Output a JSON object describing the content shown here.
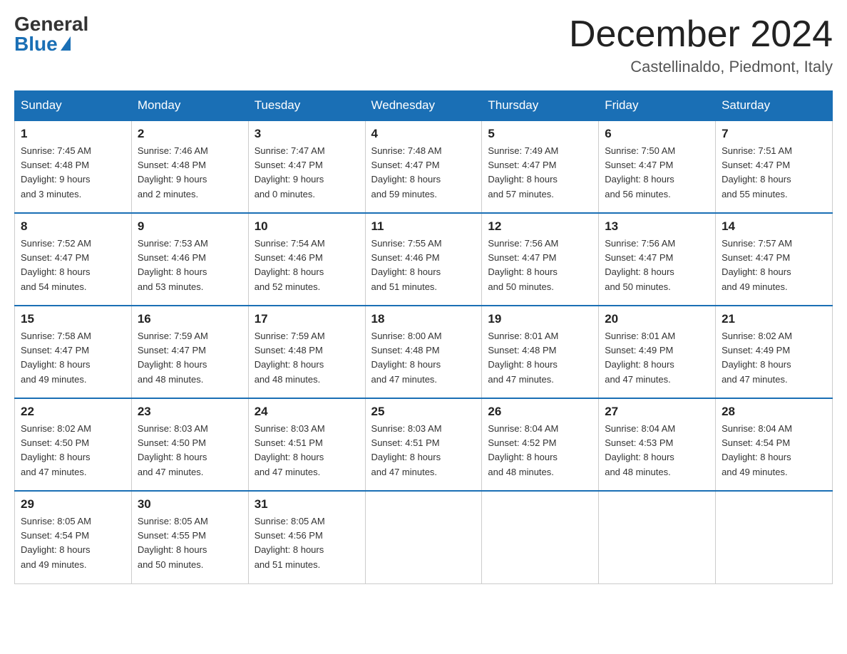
{
  "header": {
    "logo_general": "General",
    "logo_blue": "Blue",
    "title": "December 2024",
    "subtitle": "Castellinaldo, Piedmont, Italy"
  },
  "days_of_week": [
    "Sunday",
    "Monday",
    "Tuesday",
    "Wednesday",
    "Thursday",
    "Friday",
    "Saturday"
  ],
  "weeks": [
    [
      {
        "num": "1",
        "info": "Sunrise: 7:45 AM\nSunset: 4:48 PM\nDaylight: 9 hours\nand 3 minutes."
      },
      {
        "num": "2",
        "info": "Sunrise: 7:46 AM\nSunset: 4:48 PM\nDaylight: 9 hours\nand 2 minutes."
      },
      {
        "num": "3",
        "info": "Sunrise: 7:47 AM\nSunset: 4:47 PM\nDaylight: 9 hours\nand 0 minutes."
      },
      {
        "num": "4",
        "info": "Sunrise: 7:48 AM\nSunset: 4:47 PM\nDaylight: 8 hours\nand 59 minutes."
      },
      {
        "num": "5",
        "info": "Sunrise: 7:49 AM\nSunset: 4:47 PM\nDaylight: 8 hours\nand 57 minutes."
      },
      {
        "num": "6",
        "info": "Sunrise: 7:50 AM\nSunset: 4:47 PM\nDaylight: 8 hours\nand 56 minutes."
      },
      {
        "num": "7",
        "info": "Sunrise: 7:51 AM\nSunset: 4:47 PM\nDaylight: 8 hours\nand 55 minutes."
      }
    ],
    [
      {
        "num": "8",
        "info": "Sunrise: 7:52 AM\nSunset: 4:47 PM\nDaylight: 8 hours\nand 54 minutes."
      },
      {
        "num": "9",
        "info": "Sunrise: 7:53 AM\nSunset: 4:46 PM\nDaylight: 8 hours\nand 53 minutes."
      },
      {
        "num": "10",
        "info": "Sunrise: 7:54 AM\nSunset: 4:46 PM\nDaylight: 8 hours\nand 52 minutes."
      },
      {
        "num": "11",
        "info": "Sunrise: 7:55 AM\nSunset: 4:46 PM\nDaylight: 8 hours\nand 51 minutes."
      },
      {
        "num": "12",
        "info": "Sunrise: 7:56 AM\nSunset: 4:47 PM\nDaylight: 8 hours\nand 50 minutes."
      },
      {
        "num": "13",
        "info": "Sunrise: 7:56 AM\nSunset: 4:47 PM\nDaylight: 8 hours\nand 50 minutes."
      },
      {
        "num": "14",
        "info": "Sunrise: 7:57 AM\nSunset: 4:47 PM\nDaylight: 8 hours\nand 49 minutes."
      }
    ],
    [
      {
        "num": "15",
        "info": "Sunrise: 7:58 AM\nSunset: 4:47 PM\nDaylight: 8 hours\nand 49 minutes."
      },
      {
        "num": "16",
        "info": "Sunrise: 7:59 AM\nSunset: 4:47 PM\nDaylight: 8 hours\nand 48 minutes."
      },
      {
        "num": "17",
        "info": "Sunrise: 7:59 AM\nSunset: 4:48 PM\nDaylight: 8 hours\nand 48 minutes."
      },
      {
        "num": "18",
        "info": "Sunrise: 8:00 AM\nSunset: 4:48 PM\nDaylight: 8 hours\nand 47 minutes."
      },
      {
        "num": "19",
        "info": "Sunrise: 8:01 AM\nSunset: 4:48 PM\nDaylight: 8 hours\nand 47 minutes."
      },
      {
        "num": "20",
        "info": "Sunrise: 8:01 AM\nSunset: 4:49 PM\nDaylight: 8 hours\nand 47 minutes."
      },
      {
        "num": "21",
        "info": "Sunrise: 8:02 AM\nSunset: 4:49 PM\nDaylight: 8 hours\nand 47 minutes."
      }
    ],
    [
      {
        "num": "22",
        "info": "Sunrise: 8:02 AM\nSunset: 4:50 PM\nDaylight: 8 hours\nand 47 minutes."
      },
      {
        "num": "23",
        "info": "Sunrise: 8:03 AM\nSunset: 4:50 PM\nDaylight: 8 hours\nand 47 minutes."
      },
      {
        "num": "24",
        "info": "Sunrise: 8:03 AM\nSunset: 4:51 PM\nDaylight: 8 hours\nand 47 minutes."
      },
      {
        "num": "25",
        "info": "Sunrise: 8:03 AM\nSunset: 4:51 PM\nDaylight: 8 hours\nand 47 minutes."
      },
      {
        "num": "26",
        "info": "Sunrise: 8:04 AM\nSunset: 4:52 PM\nDaylight: 8 hours\nand 48 minutes."
      },
      {
        "num": "27",
        "info": "Sunrise: 8:04 AM\nSunset: 4:53 PM\nDaylight: 8 hours\nand 48 minutes."
      },
      {
        "num": "28",
        "info": "Sunrise: 8:04 AM\nSunset: 4:54 PM\nDaylight: 8 hours\nand 49 minutes."
      }
    ],
    [
      {
        "num": "29",
        "info": "Sunrise: 8:05 AM\nSunset: 4:54 PM\nDaylight: 8 hours\nand 49 minutes."
      },
      {
        "num": "30",
        "info": "Sunrise: 8:05 AM\nSunset: 4:55 PM\nDaylight: 8 hours\nand 50 minutes."
      },
      {
        "num": "31",
        "info": "Sunrise: 8:05 AM\nSunset: 4:56 PM\nDaylight: 8 hours\nand 51 minutes."
      },
      null,
      null,
      null,
      null
    ]
  ]
}
